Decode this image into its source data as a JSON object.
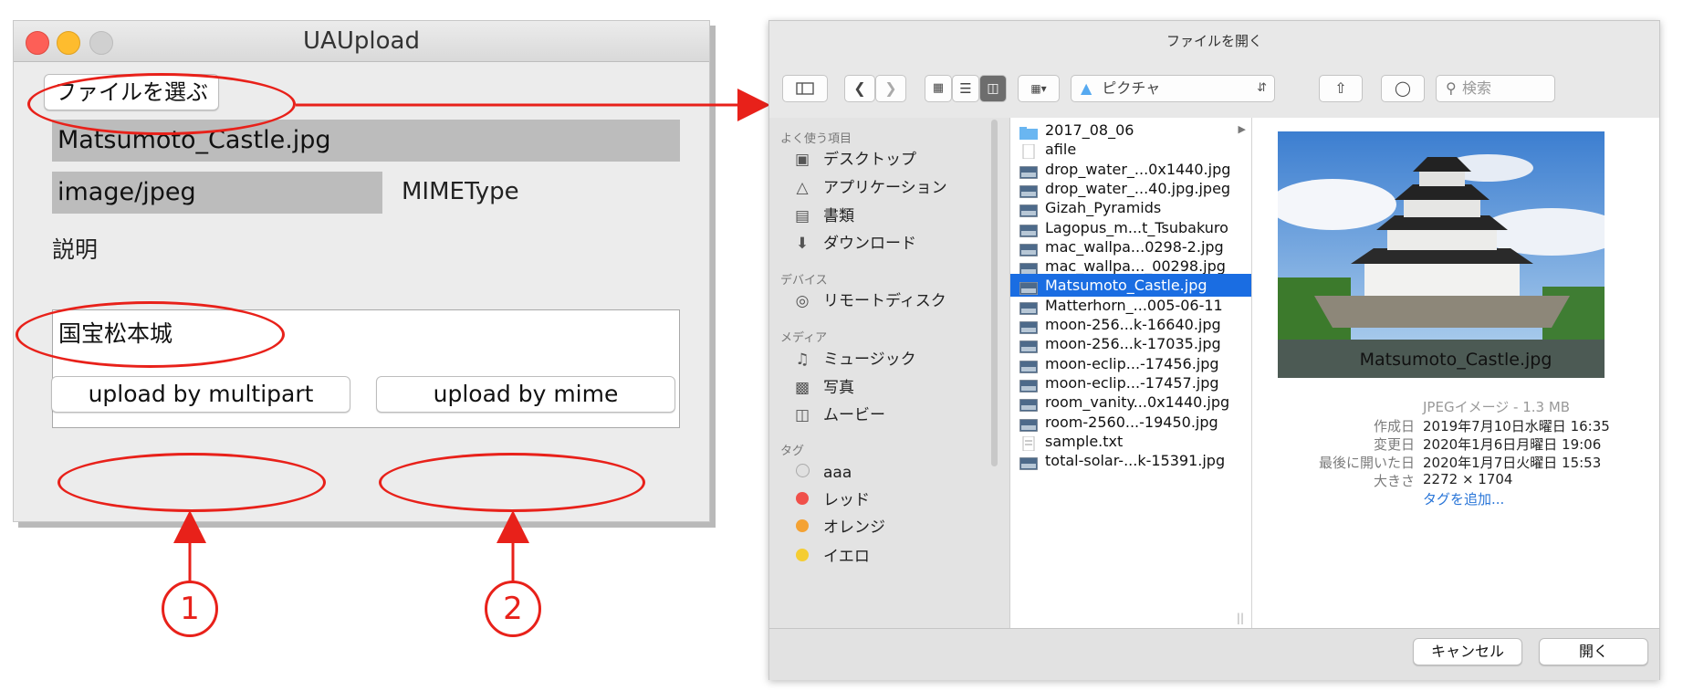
{
  "app": {
    "title": "UAUpload",
    "choose_file_label": "ファイルを選ぶ",
    "file_name_value": "Matsumoto_Castle.jpg",
    "mime_value": "image/jpeg",
    "mime_label": "MIMEType",
    "description_label": "説明",
    "description_value": "国宝松本城",
    "upload_multipart_label": "upload by multipart",
    "upload_mime_label": "upload by mime",
    "colors": {
      "close": "#fd5f57",
      "minimize": "#febc2e",
      "zoom": "#d0d0d0"
    }
  },
  "annotations": {
    "marker_1": "1",
    "marker_2": "2",
    "color": "#e8211a"
  },
  "dialog": {
    "title": "ファイルを開く",
    "location": "ピクチャ",
    "search_placeholder": "検索",
    "sidebar": {
      "favorites_header": "よく使う項目",
      "favorites": [
        {
          "label": "デスクトップ",
          "icon": "desktop-icon"
        },
        {
          "label": "アプリケーション",
          "icon": "applications-icon"
        },
        {
          "label": "書類",
          "icon": "documents-icon"
        },
        {
          "label": "ダウンロード",
          "icon": "downloads-icon"
        }
      ],
      "devices_header": "デバイス",
      "devices": [
        {
          "label": "リモートディスク",
          "icon": "disc-icon"
        }
      ],
      "media_header": "メディア",
      "media": [
        {
          "label": "ミュージック",
          "icon": "music-icon"
        },
        {
          "label": "写真",
          "icon": "camera-icon"
        },
        {
          "label": "ムービー",
          "icon": "film-icon"
        }
      ],
      "tags_header": "タグ",
      "tags": [
        {
          "label": "aaa",
          "color": "#e0e0e0"
        },
        {
          "label": "レッド",
          "color": "#f0504a"
        },
        {
          "label": "オレンジ",
          "color": "#f4a233"
        },
        {
          "label": "イエロ",
          "color": "#f5cd32"
        }
      ]
    },
    "files": [
      {
        "name": "2017_08_06",
        "kind": "folder"
      },
      {
        "name": "afile",
        "kind": "blank"
      },
      {
        "name": "drop_water_...0x1440.jpg",
        "kind": "image"
      },
      {
        "name": "drop_water_...40.jpg.jpeg",
        "kind": "image"
      },
      {
        "name": "Gizah_Pyramids",
        "kind": "image"
      },
      {
        "name": "Lagopus_m...t_Tsubakuro",
        "kind": "image"
      },
      {
        "name": "mac_wallpa...0298-2.jpg",
        "kind": "image"
      },
      {
        "name": "mac_wallpa..._00298.jpg",
        "kind": "image"
      },
      {
        "name": "Matsumoto_Castle.jpg",
        "kind": "image",
        "selected": true
      },
      {
        "name": "Matterhorn_...005-06-11",
        "kind": "image"
      },
      {
        "name": "moon-256...k-16640.jpg",
        "kind": "image"
      },
      {
        "name": "moon-256...k-17035.jpg",
        "kind": "image"
      },
      {
        "name": "moon-eclip...-17456.jpg",
        "kind": "image"
      },
      {
        "name": "moon-eclip...-17457.jpg",
        "kind": "image"
      },
      {
        "name": "room_vanity...0x1440.jpg",
        "kind": "image"
      },
      {
        "name": "room-2560...-19450.jpg",
        "kind": "image"
      },
      {
        "name": "sample.txt",
        "kind": "text"
      },
      {
        "name": "total-solar-...k-15391.jpg",
        "kind": "image"
      }
    ],
    "preview": {
      "file_name": "Matsumoto_Castle.jpg",
      "kind_size": "JPEGイメージ - 1.3 MB",
      "created_label": "作成日",
      "created_value": "2019年7月10日水曜日 16:35",
      "modified_label": "変更日",
      "modified_value": "2020年1月6日月曜日 19:06",
      "opened_label": "最後に開いた日",
      "opened_value": "2020年1月7日火曜日 15:53",
      "size_label": "大きさ",
      "size_value": "2272 × 1704",
      "add_tag_link": "タグを追加..."
    },
    "cancel_label": "キャンセル",
    "open_label": "開く"
  }
}
